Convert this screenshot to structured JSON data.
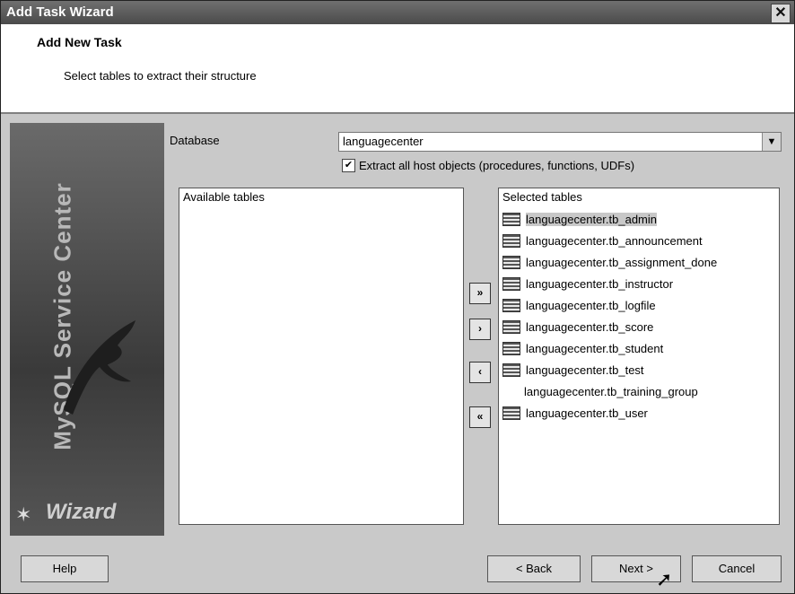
{
  "window": {
    "title": "Add Task Wizard",
    "close_glyph": "✕"
  },
  "header": {
    "title": "Add New Task",
    "subtitle": "Select tables to extract their structure"
  },
  "sidebar": {
    "vertical_text": "MySQL Service Center",
    "wizard_label": "Wizard"
  },
  "database": {
    "label": "Database",
    "value": "languagecenter"
  },
  "extract_host_objects": {
    "checked": true,
    "label": "Extract all host objects (procedures, functions, UDFs)"
  },
  "available_tables": {
    "header": "Available tables",
    "items": []
  },
  "selected_tables": {
    "header": "Selected tables",
    "items": [
      {
        "name": "languagecenter.tb_admin",
        "icon": "table-icon"
      },
      {
        "name": "languagecenter.tb_announcement",
        "icon": "table-icon"
      },
      {
        "name": "languagecenter.tb_assignment_done",
        "icon": "table-icon"
      },
      {
        "name": "languagecenter.tb_instructor",
        "icon": "table-icon"
      },
      {
        "name": "languagecenter.tb_logfile",
        "icon": "table-icon"
      },
      {
        "name": "languagecenter.tb_score",
        "icon": "table-icon"
      },
      {
        "name": "languagecenter.tb_student",
        "icon": "table-icon"
      },
      {
        "name": "languagecenter.tb_test",
        "icon": "table-icon"
      },
      {
        "name": "languagecenter.tb_training_group",
        "icon": "none"
      },
      {
        "name": "languagecenter.tb_user",
        "icon": "table-icon"
      }
    ]
  },
  "move_buttons": {
    "add_all": "»",
    "add": "›",
    "remove": "‹",
    "remove_all": "«"
  },
  "buttons": {
    "help": "Help",
    "back": "< Back",
    "next": "Next >",
    "cancel": "Cancel"
  }
}
